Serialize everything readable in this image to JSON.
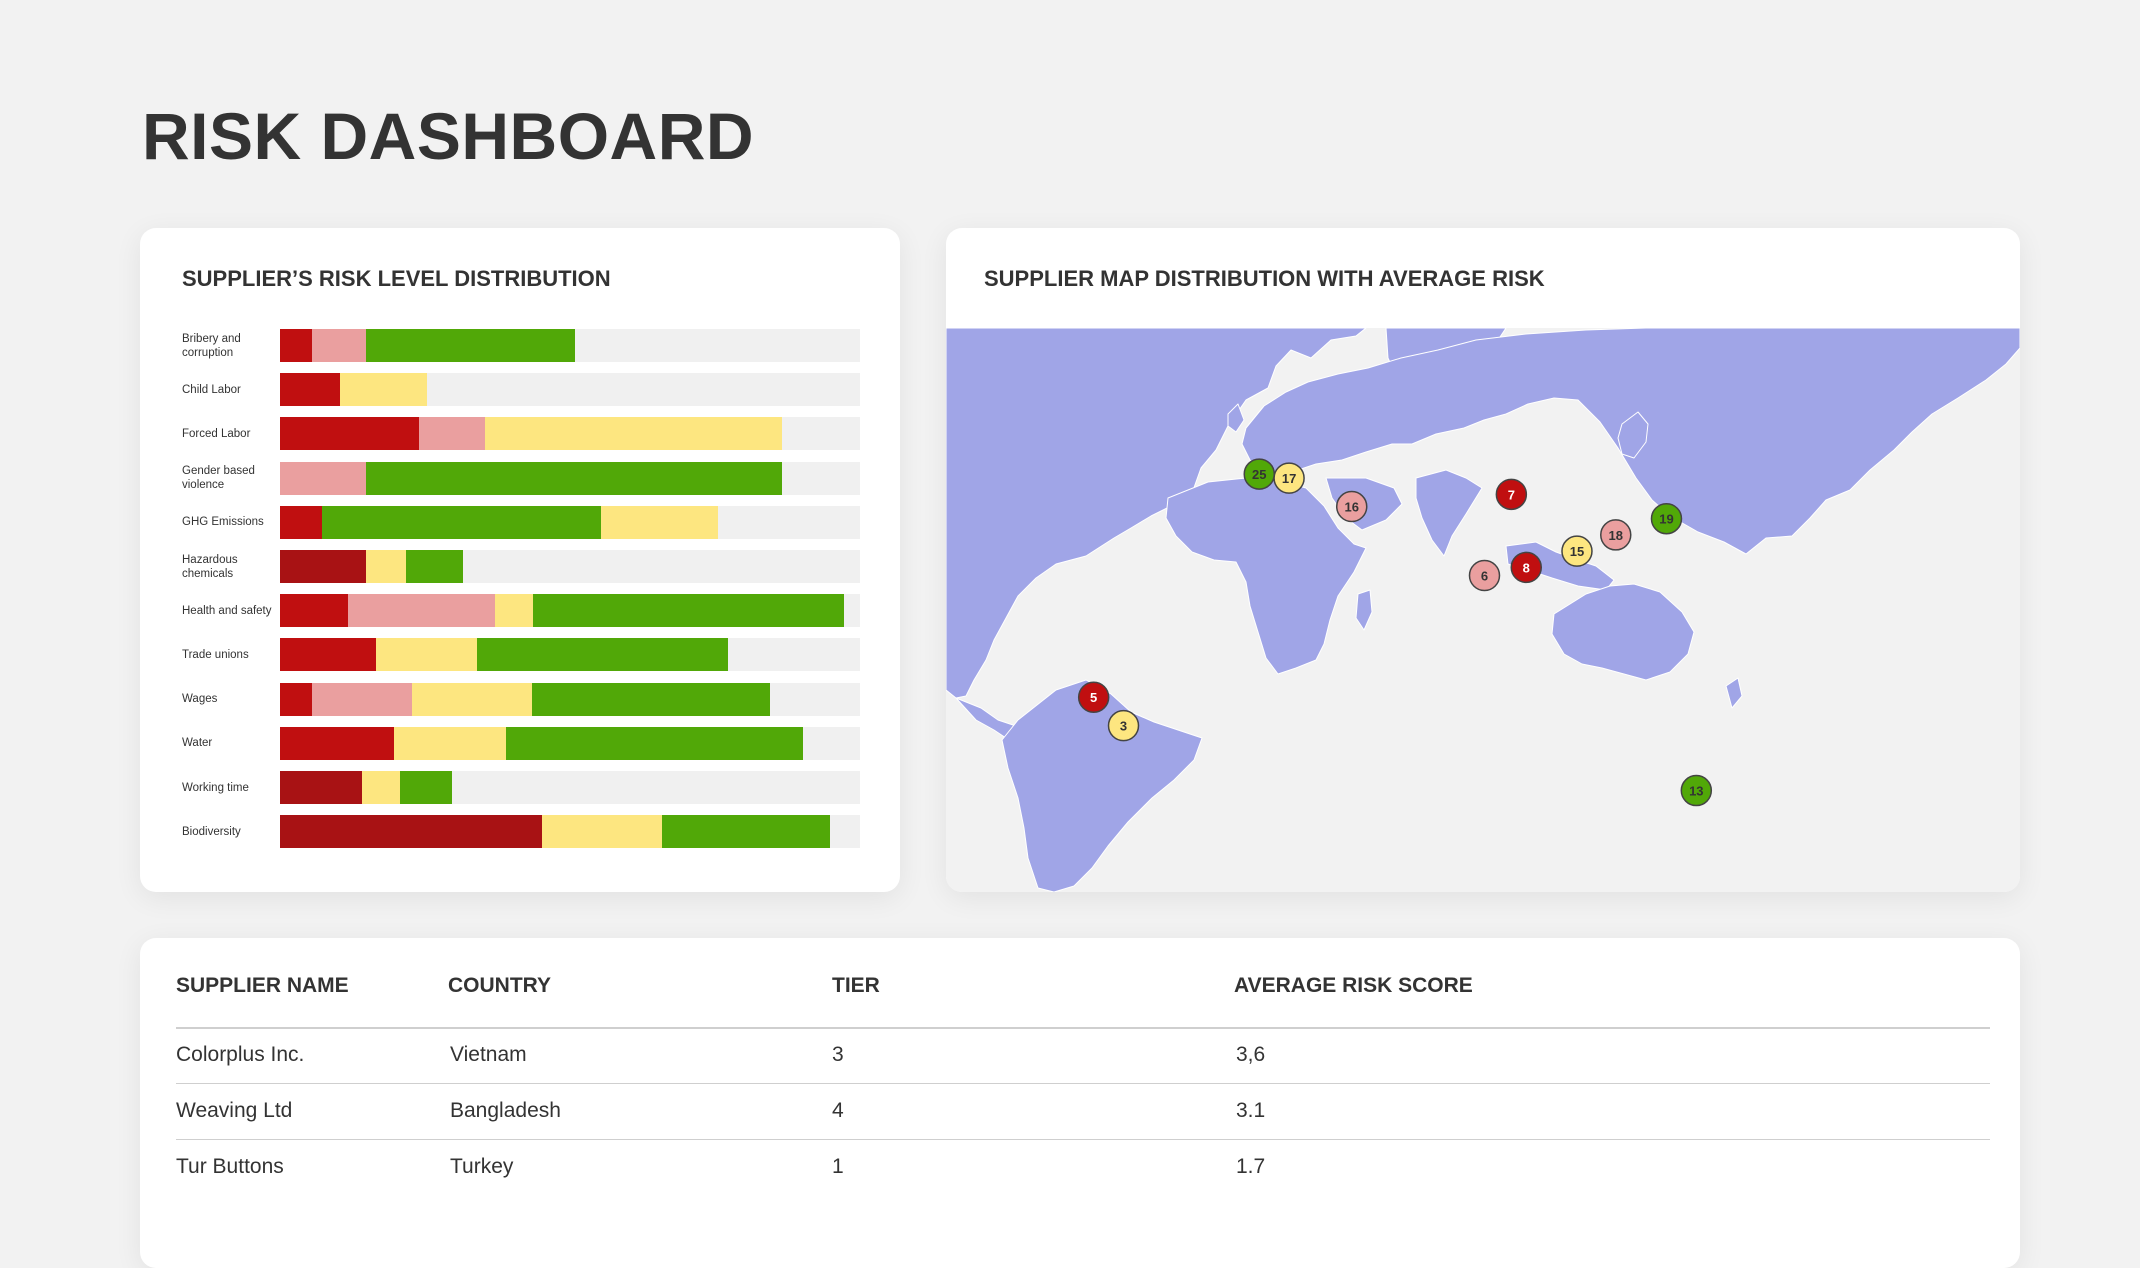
{
  "page": {
    "title": "RISK DASHBOARD"
  },
  "colors": {
    "high": "#c00f10",
    "very_high": "#a81214",
    "medium": "#ea9f9f",
    "low": "#fde680",
    "very_low": "#51a808",
    "track": "#f0f0f0",
    "land": "#a0a5e7",
    "ocean": "#f2f2f2"
  },
  "risk_distribution": {
    "title": "SUPPLIER’S RISK LEVEL DISTRIBUTION",
    "rows": [
      {
        "label": "Bribery and corruption",
        "segments": [
          {
            "level": "high",
            "share": 0.055
          },
          {
            "level": "medium",
            "share": 0.093
          },
          {
            "level": "very_low",
            "share": 0.36
          }
        ]
      },
      {
        "label": "Child Labor",
        "segments": [
          {
            "level": "high",
            "share": 0.104
          },
          {
            "level": "low",
            "share": 0.15
          }
        ]
      },
      {
        "label": "Forced Labor",
        "segments": [
          {
            "level": "high",
            "share": 0.24
          },
          {
            "level": "medium",
            "share": 0.114
          },
          {
            "level": "low",
            "share": 0.511
          }
        ]
      },
      {
        "label": "Gender based violence",
        "segments": [
          {
            "level": "medium",
            "share": 0.148
          },
          {
            "level": "very_low",
            "share": 0.718
          }
        ]
      },
      {
        "label": "GHG Emissions",
        "segments": [
          {
            "level": "high",
            "share": 0.073
          },
          {
            "level": "very_low",
            "share": 0.48
          },
          {
            "level": "low",
            "share": 0.203
          }
        ]
      },
      {
        "label": "Hazardous chemicals",
        "segments": [
          {
            "level": "very_high",
            "share": 0.148
          },
          {
            "level": "low",
            "share": 0.07
          },
          {
            "level": "very_low",
            "share": 0.097
          }
        ]
      },
      {
        "label": "Health and safety",
        "segments": [
          {
            "level": "high",
            "share": 0.118
          },
          {
            "level": "medium",
            "share": 0.252
          },
          {
            "level": "low",
            "share": 0.066
          },
          {
            "level": "very_low",
            "share": 0.536
          }
        ]
      },
      {
        "label": "Trade unions",
        "segments": [
          {
            "level": "high",
            "share": 0.165
          },
          {
            "level": "low",
            "share": 0.174
          },
          {
            "level": "very_low",
            "share": 0.433
          }
        ]
      },
      {
        "label": "Wages",
        "segments": [
          {
            "level": "high",
            "share": 0.055
          },
          {
            "level": "medium",
            "share": 0.172
          },
          {
            "level": "low",
            "share": 0.207
          },
          {
            "level": "very_low",
            "share": 0.411
          }
        ]
      },
      {
        "label": "Water",
        "segments": [
          {
            "level": "high",
            "share": 0.197
          },
          {
            "level": "low",
            "share": 0.193
          },
          {
            "level": "very_low",
            "share": 0.511
          }
        ]
      },
      {
        "label": "Working time",
        "segments": [
          {
            "level": "very_high",
            "share": 0.141
          },
          {
            "level": "low",
            "share": 0.066
          },
          {
            "level": "very_low",
            "share": 0.09
          }
        ]
      },
      {
        "label": "Biodiversity",
        "segments": [
          {
            "level": "very_high",
            "share": 0.452
          },
          {
            "level": "low",
            "share": 0.207
          },
          {
            "level": "very_low",
            "share": 0.289
          }
        ]
      }
    ]
  },
  "map": {
    "title": "SUPPLIER MAP DISTRIBUTION WITH AVERAGE RISK",
    "markers": [
      {
        "label": "25",
        "level": "very_low",
        "lon": 2.5,
        "lat": 47
      },
      {
        "label": "17",
        "level": "low",
        "lon": 12.5,
        "lat": 46
      },
      {
        "label": "16",
        "level": "medium",
        "lon": 33.5,
        "lat": 39
      },
      {
        "label": "7",
        "level": "high",
        "lon": 87,
        "lat": 42
      },
      {
        "label": "6",
        "level": "medium",
        "lon": 78,
        "lat": 22
      },
      {
        "label": "8",
        "level": "high",
        "lon": 92,
        "lat": 24
      },
      {
        "label": "15",
        "level": "low",
        "lon": 109,
        "lat": 28
      },
      {
        "label": "18",
        "level": "medium",
        "lon": 122,
        "lat": 32
      },
      {
        "label": "19",
        "level": "very_low",
        "lon": 139,
        "lat": 36
      },
      {
        "label": "5",
        "level": "high",
        "lon": -53,
        "lat": -8
      },
      {
        "label": "3",
        "level": "low",
        "lon": -43,
        "lat": -15
      },
      {
        "label": "13",
        "level": "very_low",
        "lon": 149,
        "lat": -31
      }
    ]
  },
  "table": {
    "headers": {
      "name": "SUPPLIER NAME",
      "country": "COUNTRY",
      "tier": "TIER",
      "score": "AVERAGE RISK SCORE"
    },
    "rows": [
      {
        "name": "Colorplus Inc.",
        "country": "Vietnam",
        "tier": "3",
        "score": "3,6"
      },
      {
        "name": "Weaving Ltd",
        "country": "Bangladesh",
        "tier": "4",
        "score": "3.1"
      },
      {
        "name": "Tur Buttons",
        "country": "Turkey",
        "tier": "1",
        "score": "1.7"
      }
    ]
  }
}
